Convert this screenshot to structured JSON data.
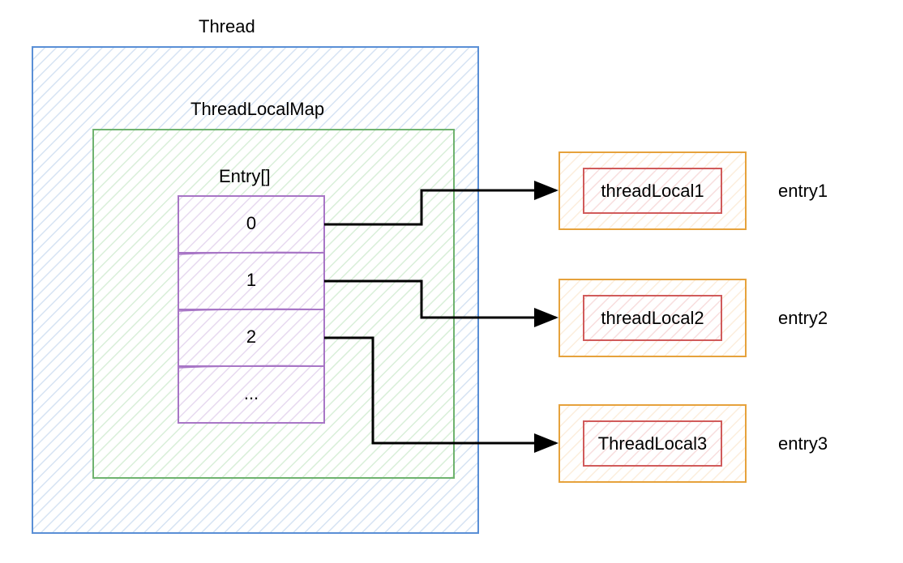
{
  "diagram": {
    "thread_title": "Thread",
    "map_title": "ThreadLocalMap",
    "entry_array_title": "Entry[]",
    "cells": [
      "0",
      "1",
      "2",
      "..."
    ],
    "entries": [
      {
        "inner": "threadLocal1",
        "right": "entry1"
      },
      {
        "inner": "threadLocal2",
        "right": "entry2"
      },
      {
        "inner": "ThreadLocal3",
        "right": "entry3"
      }
    ],
    "colors": {
      "thread_border": "#5a8fd6",
      "map_border": "#6fb36f",
      "cell_border": "#a876c6",
      "entry_outer": "#e6a23c",
      "entry_inner": "#d15b5b",
      "hatch": "#d6e3f3",
      "hatch_green": "#d9efd9",
      "hatch_purple": "#e7daf0",
      "hatch_orange": "#fceedd",
      "hatch_red": "#f8dede"
    }
  }
}
